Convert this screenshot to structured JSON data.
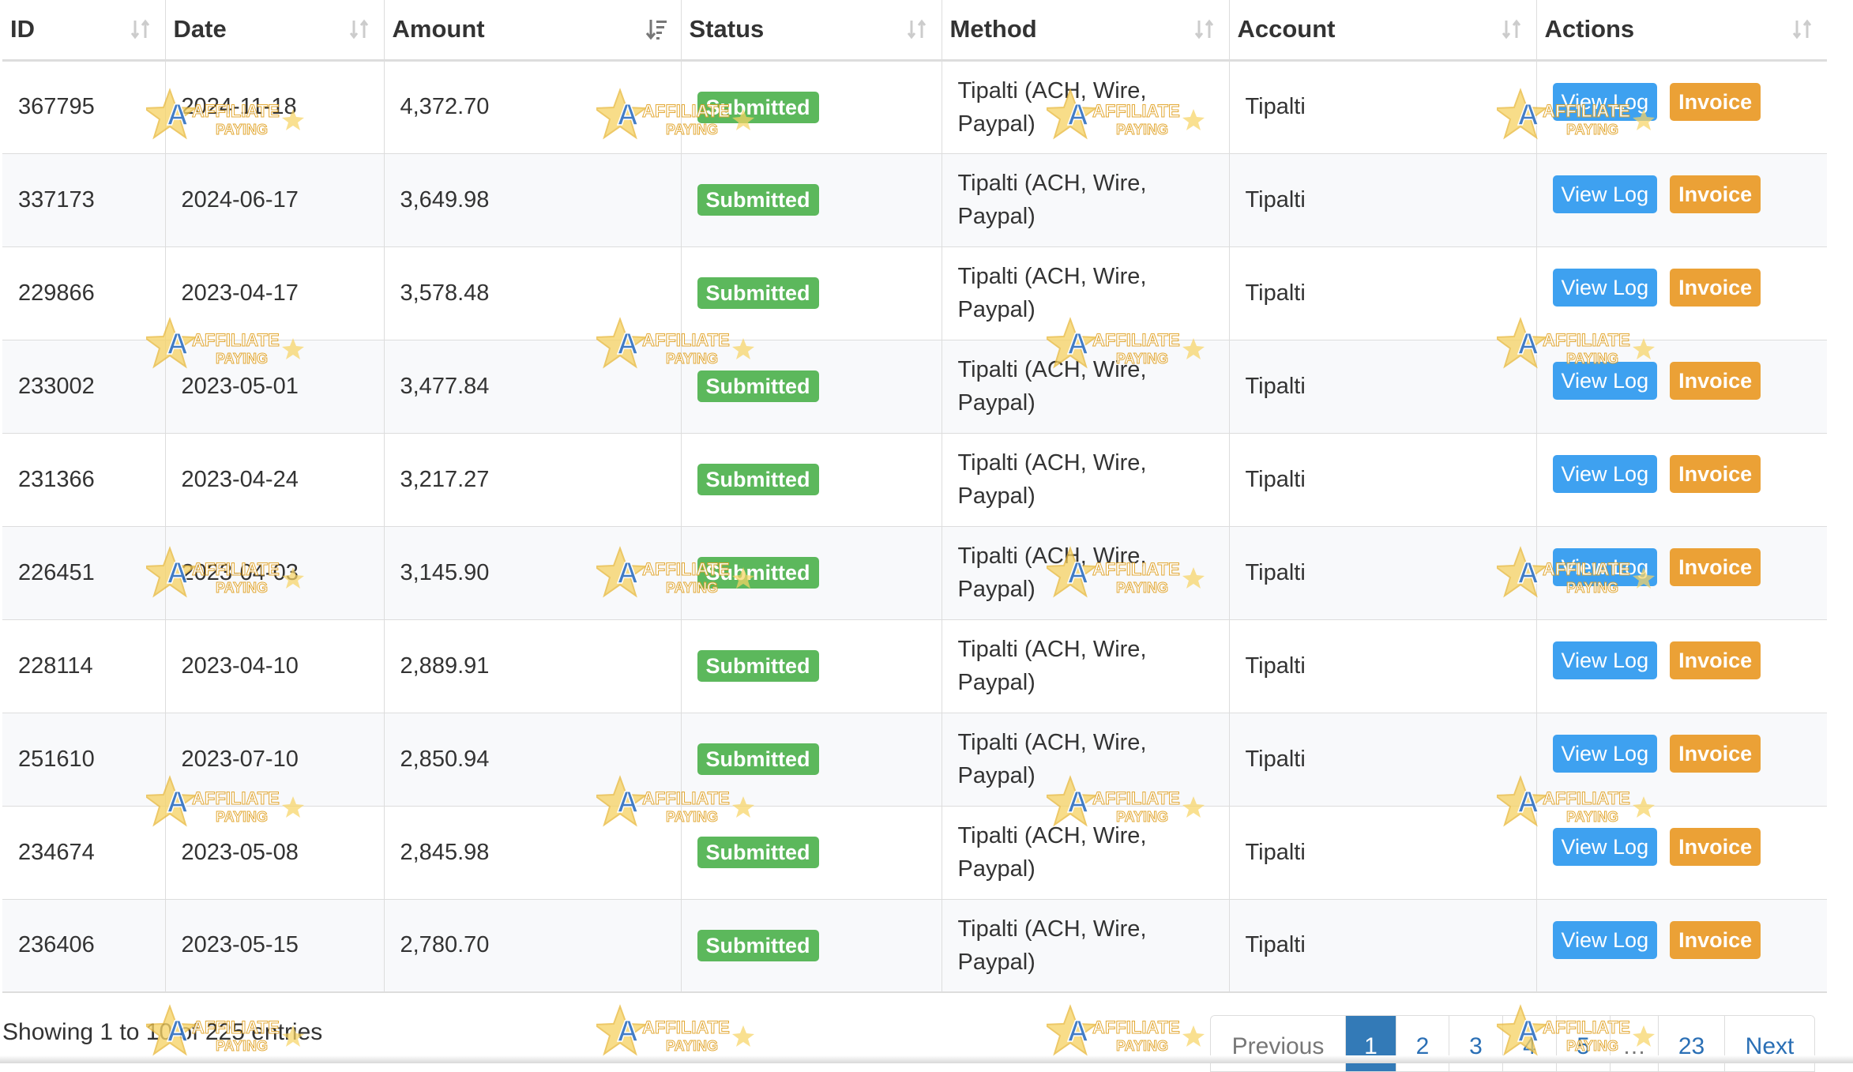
{
  "table": {
    "columns": [
      {
        "label": "ID",
        "sort": "none"
      },
      {
        "label": "Date",
        "sort": "none"
      },
      {
        "label": "Amount",
        "sort": "desc"
      },
      {
        "label": "Status",
        "sort": "none"
      },
      {
        "label": "Method",
        "sort": "none"
      },
      {
        "label": "Account",
        "sort": "none"
      },
      {
        "label": "Actions",
        "sort": "none"
      }
    ],
    "rows": [
      {
        "id": "367795",
        "date": "2024-11-18",
        "amount": "4,372.70",
        "status": "Submitted",
        "method": "Tipalti (ACH, Wire, Paypal)",
        "account": "Tipalti"
      },
      {
        "id": "337173",
        "date": "2024-06-17",
        "amount": "3,649.98",
        "status": "Submitted",
        "method": "Tipalti (ACH, Wire, Paypal)",
        "account": "Tipalti"
      },
      {
        "id": "229866",
        "date": "2023-04-17",
        "amount": "3,578.48",
        "status": "Submitted",
        "method": "Tipalti (ACH, Wire, Paypal)",
        "account": "Tipalti"
      },
      {
        "id": "233002",
        "date": "2023-05-01",
        "amount": "3,477.84",
        "status": "Submitted",
        "method": "Tipalti (ACH, Wire, Paypal)",
        "account": "Tipalti"
      },
      {
        "id": "231366",
        "date": "2023-04-24",
        "amount": "3,217.27",
        "status": "Submitted",
        "method": "Tipalti (ACH, Wire, Paypal)",
        "account": "Tipalti"
      },
      {
        "id": "226451",
        "date": "2023-04-03",
        "amount": "3,145.90",
        "status": "Submitted",
        "method": "Tipalti (ACH, Wire, Paypal)",
        "account": "Tipalti"
      },
      {
        "id": "228114",
        "date": "2023-04-10",
        "amount": "2,889.91",
        "status": "Submitted",
        "method": "Tipalti (ACH, Wire, Paypal)",
        "account": "Tipalti"
      },
      {
        "id": "251610",
        "date": "2023-07-10",
        "amount": "2,850.94",
        "status": "Submitted",
        "method": "Tipalti (ACH, Wire, Paypal)",
        "account": "Tipalti"
      },
      {
        "id": "234674",
        "date": "2023-05-08",
        "amount": "2,845.98",
        "status": "Submitted",
        "method": "Tipalti (ACH, Wire, Paypal)",
        "account": "Tipalti"
      },
      {
        "id": "236406",
        "date": "2023-05-15",
        "amount": "2,780.70",
        "status": "Submitted",
        "method": "Tipalti (ACH, Wire, Paypal)",
        "account": "Tipalti"
      }
    ],
    "actions": {
      "view_log_label": "View Log",
      "invoice_label": "Invoice"
    }
  },
  "footer": {
    "info": "Showing 1 to 10 of 225 entries"
  },
  "pagination": {
    "previous_label": "Previous",
    "next_label": "Next",
    "pages": [
      "1",
      "2",
      "3",
      "4",
      "5",
      "…",
      "23"
    ],
    "current": "1"
  },
  "watermark": {
    "text_top": "AFFILIATE",
    "text_bottom": "PAYING"
  },
  "colors": {
    "status_submitted": "#5cb85c",
    "view_log_button": "#3ea1f0",
    "invoice_button": "#eba136",
    "pagination_active": "#337ab7",
    "link": "#2a6fb5"
  }
}
